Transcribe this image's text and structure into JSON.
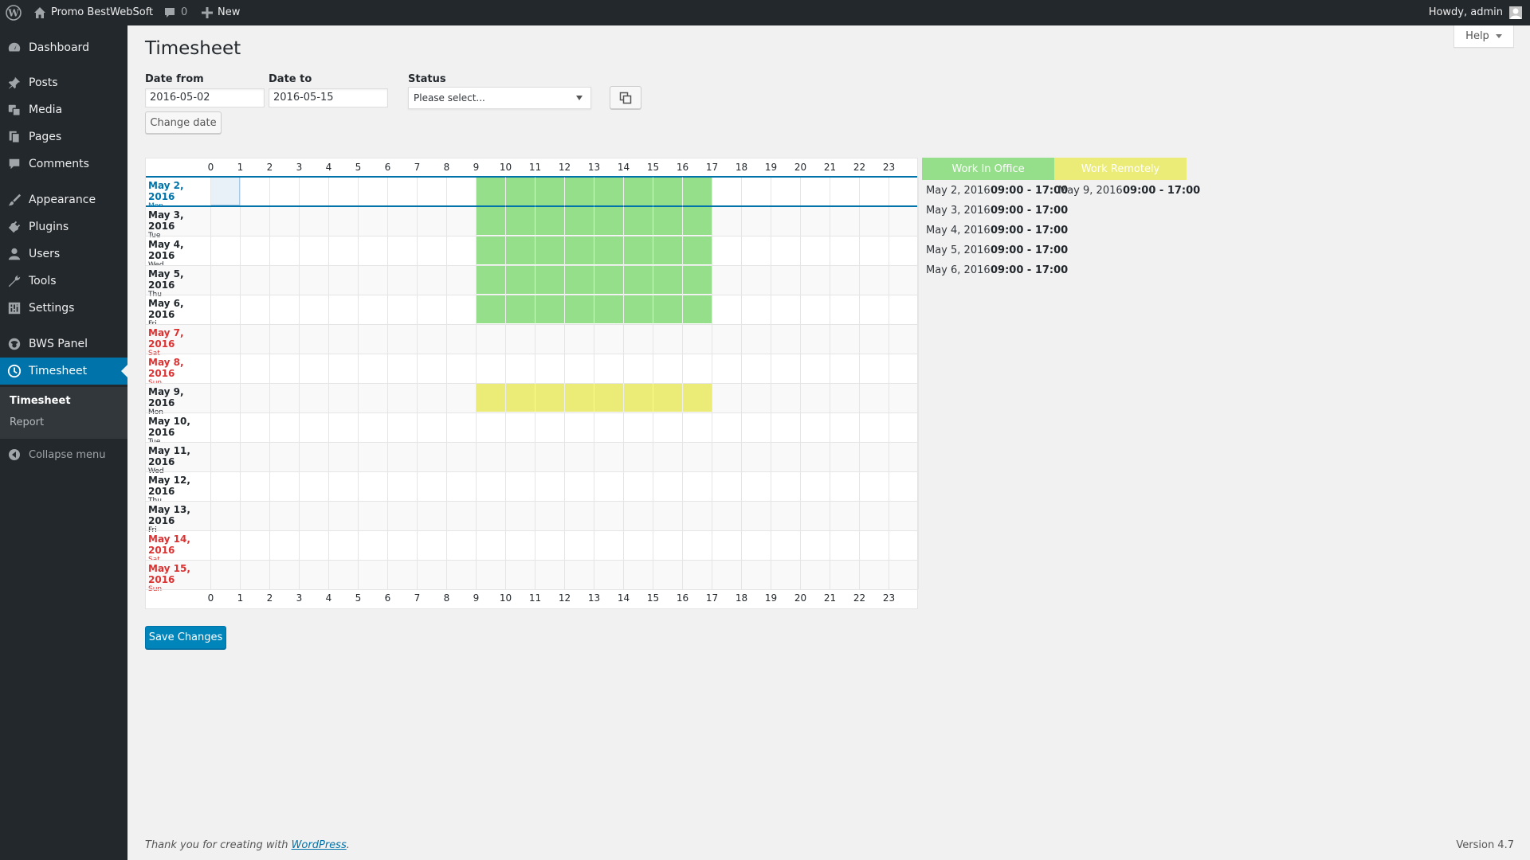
{
  "adminbar": {
    "site_name": "Promo BestWebSoft",
    "comments_count": "0",
    "new_label": "New",
    "howdy": "Howdy, admin"
  },
  "sidebar": {
    "items": [
      {
        "label": "Dashboard",
        "icon": "dashboard-icon"
      },
      {
        "label": "Posts",
        "icon": "pin-icon"
      },
      {
        "label": "Media",
        "icon": "media-icon"
      },
      {
        "label": "Pages",
        "icon": "pages-icon"
      },
      {
        "label": "Comments",
        "icon": "comment-icon"
      },
      {
        "label": "Appearance",
        "icon": "brush-icon"
      },
      {
        "label": "Plugins",
        "icon": "plug-icon"
      },
      {
        "label": "Users",
        "icon": "user-icon"
      },
      {
        "label": "Tools",
        "icon": "wrench-icon"
      },
      {
        "label": "Settings",
        "icon": "settings-icon"
      },
      {
        "label": "BWS Panel",
        "icon": "bws-icon"
      },
      {
        "label": "Timesheet",
        "icon": "clock-icon"
      }
    ],
    "submenu": [
      "Timesheet",
      "Report"
    ],
    "collapse_label": "Collapse menu"
  },
  "page": {
    "title": "Timesheet",
    "help_label": "Help",
    "date_from_label": "Date from",
    "date_from_value": "2016-05-02",
    "date_to_label": "Date to",
    "date_to_value": "2016-05-15",
    "status_label": "Status",
    "status_placeholder": "Please select...",
    "change_date_label": "Change date",
    "save_label": "Save Changes"
  },
  "grid": {
    "hours": [
      "0",
      "1",
      "2",
      "3",
      "4",
      "5",
      "6",
      "7",
      "8",
      "9",
      "10",
      "11",
      "12",
      "13",
      "14",
      "15",
      "16",
      "17",
      "18",
      "19",
      "20",
      "21",
      "22",
      "23"
    ],
    "days": [
      {
        "date": "May 2, 2016",
        "weekday": "Mon",
        "type": "today",
        "status": "office",
        "from": 9,
        "to": 17
      },
      {
        "date": "May 3, 2016",
        "weekday": "Tue",
        "type": "weekday",
        "status": "office",
        "from": 9,
        "to": 17
      },
      {
        "date": "May 4, 2016",
        "weekday": "Wed",
        "type": "weekday",
        "status": "office",
        "from": 9,
        "to": 17
      },
      {
        "date": "May 5, 2016",
        "weekday": "Thu",
        "type": "weekday",
        "status": "office",
        "from": 9,
        "to": 17
      },
      {
        "date": "May 6, 2016",
        "weekday": "Fri",
        "type": "weekday",
        "status": "office",
        "from": 9,
        "to": 17
      },
      {
        "date": "May 7, 2016",
        "weekday": "Sat",
        "type": "weekend",
        "status": null
      },
      {
        "date": "May 8, 2016",
        "weekday": "Sun",
        "type": "weekend",
        "status": null
      },
      {
        "date": "May 9, 2016",
        "weekday": "Mon",
        "type": "weekday",
        "status": "remote",
        "from": 9,
        "to": 17
      },
      {
        "date": "May 10, 2016",
        "weekday": "Tue",
        "type": "weekday",
        "status": null
      },
      {
        "date": "May 11, 2016",
        "weekday": "Wed",
        "type": "weekday",
        "status": null
      },
      {
        "date": "May 12, 2016",
        "weekday": "Thu",
        "type": "weekday",
        "status": null
      },
      {
        "date": "May 13, 2016",
        "weekday": "Fri",
        "type": "weekday",
        "status": null
      },
      {
        "date": "May 14, 2016",
        "weekday": "Sat",
        "type": "weekend",
        "status": null
      },
      {
        "date": "May 15, 2016",
        "weekday": "Sun",
        "type": "weekend",
        "status": null
      }
    ]
  },
  "legend": {
    "office": {
      "label": "Work In Office",
      "color": "#95de8a"
    },
    "remote": {
      "label": "Work Remotely",
      "color": "#ebec77"
    }
  },
  "summary": {
    "office": [
      {
        "date": "May 2, 2016",
        "time": "09:00 - 17:00"
      },
      {
        "date": "May 3, 2016",
        "time": "09:00 - 17:00"
      },
      {
        "date": "May 4, 2016",
        "time": "09:00 - 17:00"
      },
      {
        "date": "May 5, 2016",
        "time": "09:00 - 17:00"
      },
      {
        "date": "May 6, 2016",
        "time": "09:00 - 17:00"
      }
    ],
    "remote": [
      {
        "date": "May 9, 2016",
        "time": "09:00 - 17:00"
      }
    ]
  },
  "footer": {
    "thanks_prefix": "Thank you for creating with ",
    "thanks_link": "WordPress",
    "thanks_suffix": ".",
    "version": "Version 4.7"
  }
}
